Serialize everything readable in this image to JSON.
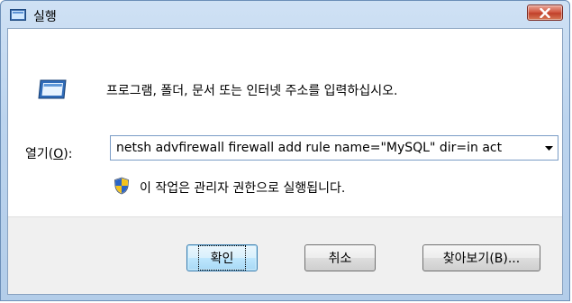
{
  "window": {
    "title": "실행",
    "close_label": "✕"
  },
  "dialog": {
    "description": "프로그램, 폴더, 문서 또는 인터넷 주소를 입력하십시오.",
    "open_label_prefix": "열기(",
    "open_label_accel": "O",
    "open_label_suffix": "):",
    "command_value": "netsh advfirewall firewall add rule name=\"MySQL\" dir=in act",
    "admin_note": "이 작업은 관리자 권한으로 실행됩니다."
  },
  "buttons": {
    "ok": "확인",
    "cancel": "취소",
    "browse": "찾아보기(B)..."
  },
  "colors": {
    "title_gradient": "#bcd4ee",
    "close_red": "#c0402a",
    "footer_bg": "#f0f0f0",
    "default_button_border": "#3c7fb1"
  }
}
